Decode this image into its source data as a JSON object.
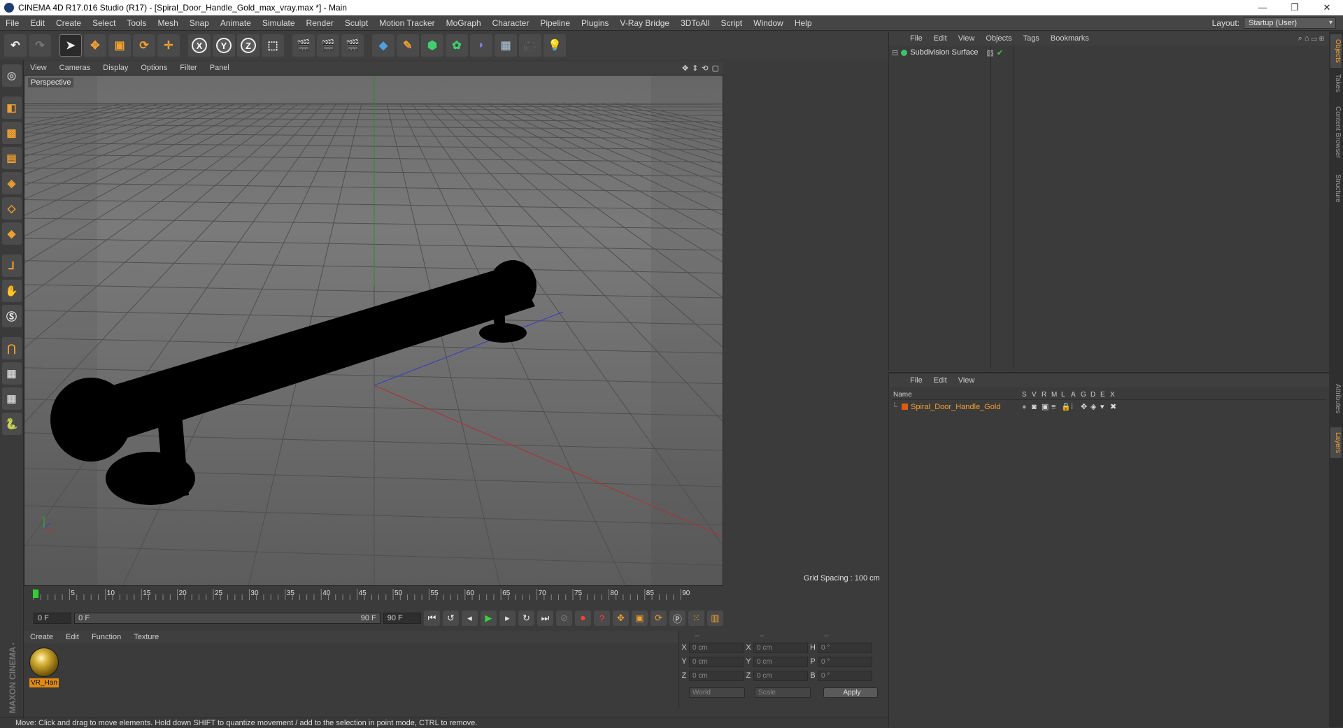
{
  "window": {
    "title": "CINEMA 4D R17.016 Studio (R17) - [Spiral_Door_Handle_Gold_max_vray.max *] - Main",
    "controls": [
      "—",
      "❐",
      "✕"
    ]
  },
  "menubar": [
    "File",
    "Edit",
    "Create",
    "Select",
    "Tools",
    "Mesh",
    "Snap",
    "Animate",
    "Simulate",
    "Render",
    "Sculpt",
    "Motion Tracker",
    "MoGraph",
    "Character",
    "Pipeline",
    "Plugins",
    "V-Ray Bridge",
    "3DToAll",
    "Script",
    "Window",
    "Help"
  ],
  "layout": {
    "label": "Layout:",
    "value": "Startup (User)"
  },
  "viewport": {
    "menu": [
      "View",
      "Cameras",
      "Display",
      "Options",
      "Filter",
      "Panel"
    ],
    "label": "Perspective",
    "grid_spacing": "Grid Spacing : 100 cm",
    "nav_icons": [
      "✥",
      "⇕",
      "⟲",
      "▢"
    ]
  },
  "timeline": {
    "ticks": [
      "0",
      "5",
      "10",
      "15",
      "20",
      "25",
      "30",
      "35",
      "40",
      "45",
      "50",
      "55",
      "60",
      "65",
      "70",
      "75",
      "80",
      "85",
      "90"
    ],
    "current_frame": "0 F",
    "start_field": "0 F",
    "range_start": "0 F",
    "range_end": "90 F",
    "end_field": "90 F"
  },
  "material_manager": {
    "menu": [
      "Create",
      "Edit",
      "Function",
      "Texture"
    ],
    "materials": [
      {
        "name": "VR_Han"
      }
    ]
  },
  "coordinates": {
    "headers": [
      "--",
      "--",
      "--"
    ],
    "rows": [
      {
        "a1": "X",
        "v1": "0 cm",
        "a2": "X",
        "v2": "0 cm",
        "a3": "H",
        "v3": "0 °"
      },
      {
        "a1": "Y",
        "v1": "0 cm",
        "a2": "Y",
        "v2": "0 cm",
        "a3": "P",
        "v3": "0 °"
      },
      {
        "a1": "Z",
        "v1": "0 cm",
        "a2": "Z",
        "v2": "0 cm",
        "a3": "B",
        "v3": "0 °"
      }
    ],
    "mode1": "World",
    "mode2": "Scale",
    "apply": "Apply"
  },
  "objects_panel": {
    "menu": [
      "File",
      "Edit",
      "View",
      "Objects",
      "Tags",
      "Bookmarks"
    ],
    "items": [
      {
        "name": "Subdivision Surface"
      }
    ]
  },
  "layers_panel": {
    "menu": [
      "File",
      "Edit",
      "View"
    ],
    "columns": [
      "Name",
      "S",
      "V",
      "R",
      "M",
      "L",
      "A",
      "G",
      "D",
      "E",
      "X"
    ],
    "items": [
      {
        "name": "Spiral_Door_Handle_Gold",
        "color": "#e05a10"
      }
    ]
  },
  "side_tabs": [
    "Objects",
    "Takes",
    "Content Browser",
    "Structure",
    "Attributes",
    "Layers"
  ],
  "status": "Move: Click and drag to move elements. Hold down SHIFT to quantize movement / add to the selection in point mode, CTRL to remove.",
  "brand": "MAXON CINEMA 4D",
  "colors": {
    "accent": "#f0a030",
    "x_axis": "#c03030",
    "y_axis": "#30a030",
    "z_axis": "#3040c0",
    "layer_text": "#f0a030"
  }
}
